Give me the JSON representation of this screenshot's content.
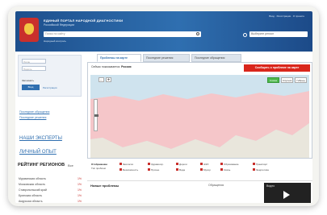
{
  "header": {
    "site_title": "ЕДИНЫЙ ПОРТАЛ НАРОДНОЙ ДИАГНОСТИКИ",
    "site_subtitle": "Российской Федерации",
    "search_placeholder": "Поиск по сайту",
    "subtitle_link": "Народный контроль",
    "top_links": "Вход · Регистрация · О проекте",
    "region_placeholder": "Выберите регион"
  },
  "login": {
    "login_placeholder": "Логин",
    "password_placeholder": "Пароль",
    "remember": "Запомнить",
    "login_button": "Вход",
    "register_link": "Регистрация"
  },
  "sidebar": {
    "links": [
      "Последние обращения",
      "Последние решения"
    ],
    "big_links": [
      "НАШИ ЭКСПЕРТЫ",
      "ЛИЧНЫЙ ОПЫТ"
    ],
    "rating_title": "РЕЙТИНГ РЕГИОНОВ",
    "rating_sub": "Все",
    "regions": [
      {
        "name": "Мурманская область",
        "value": "1%"
      },
      {
        "name": "Московская область",
        "value": "1%"
      },
      {
        "name": "Ставропольский край",
        "value": "1%"
      },
      {
        "name": "Брянская область",
        "value": "1%"
      },
      {
        "name": "Амурская область",
        "value": "1%"
      }
    ]
  },
  "tabs": [
    "Проблемы на карте",
    "Последние решения",
    "Последние обращения"
  ],
  "map": {
    "filter_label": "Сейчас показывается:",
    "filter_value": "Россия",
    "report_button": "Сообщить о проблеме на карте",
    "view_buttons": [
      "Схема",
      "Спутник",
      "Гибрид"
    ],
    "tools": [
      "↔",
      "✥"
    ]
  },
  "legend": {
    "title": "Отображение",
    "subtitle": "Тип проблем",
    "items": [
      "Экология",
      "Здравоохр.",
      "Дороги",
      "ЖКХ",
      "Образование",
      "Транспорт",
      "Безопасность",
      "Прочее",
      "Вода",
      "Мусор",
      "Связь",
      "Энергетика"
    ]
  },
  "problems": {
    "title": "Новые проблемы",
    "column": "Обращения",
    "video_title": "Видео"
  }
}
